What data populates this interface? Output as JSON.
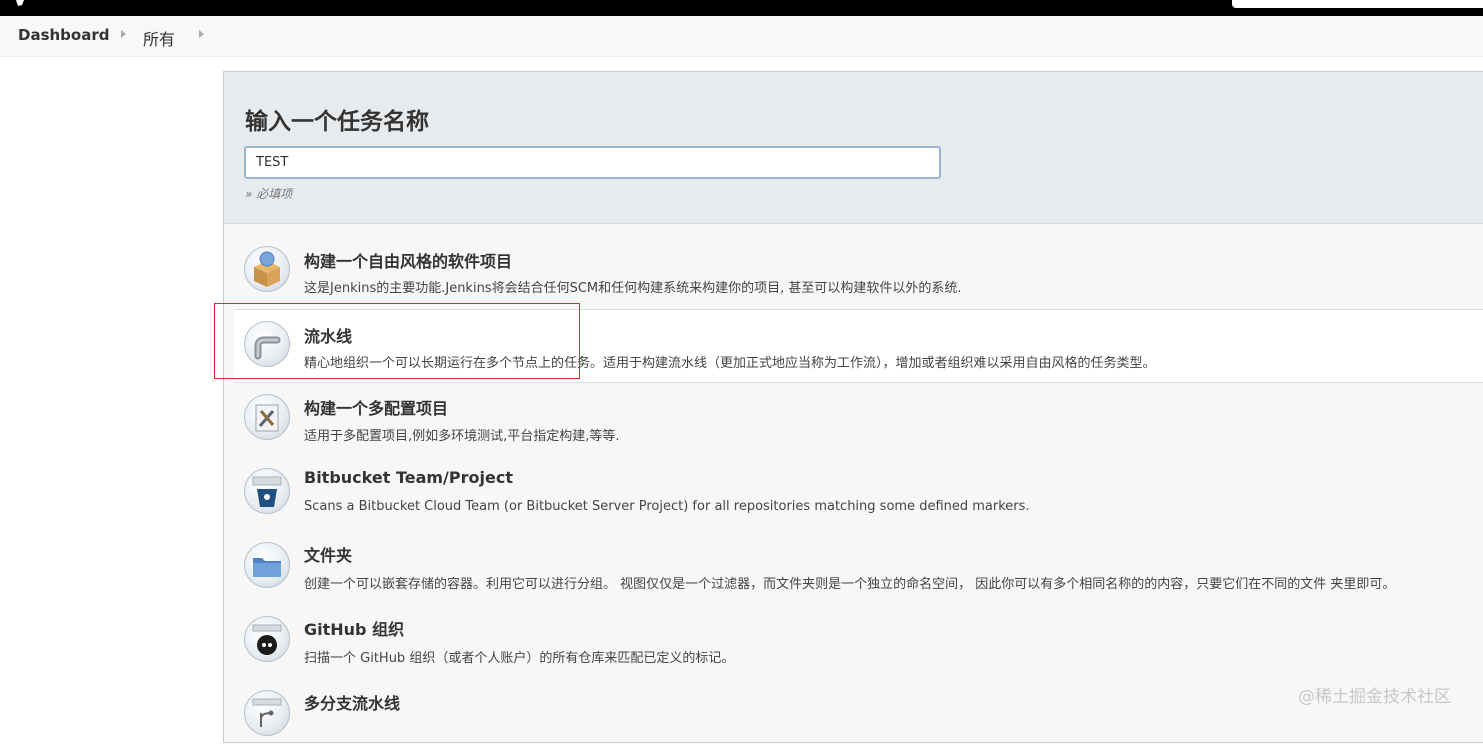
{
  "breadcrumb": {
    "dashboard": "Dashboard",
    "all": "所有"
  },
  "form": {
    "title": "输入一个任务名称",
    "name_value": "TEST",
    "required_hint": "» 必填项"
  },
  "job_types": [
    {
      "title": "构建一个自由风格的软件项目",
      "desc": "这是Jenkins的主要功能.Jenkins将会结合任何SCM和任何构建系统来构建你的项目, 甚至可以构建软件以外的系统.",
      "icon": "package-box-icon"
    },
    {
      "title": "流水线",
      "desc": "精心地组织一个可以长期运行在多个节点上的任务。适用于构建流水线（更加正式地应当称为工作流），增加或者组织难以采用自由风格的任务类型。",
      "icon": "pipe-icon"
    },
    {
      "title": "构建一个多配置项目",
      "desc": "适用于多配置项目,例如多环境测试,平台指定构建,等等.",
      "icon": "tools-icon"
    },
    {
      "title": "Bitbucket Team/Project",
      "desc": "Scans a Bitbucket Cloud Team (or Bitbucket Server Project) for all repositories matching some defined markers.",
      "icon": "bitbucket-icon"
    },
    {
      "title": "文件夹",
      "desc": "创建一个可以嵌套存储的容器。利用它可以进行分组。 视图仅仅是一个过滤器，而文件夹则是一个独立的命名空间， 因此你可以有多个相同名称的的内容，只要它们在不同的文件 夹里即可。",
      "icon": "folder-icon"
    },
    {
      "title": "GitHub 组织",
      "desc": "扫描一个 GitHub 组织（或者个人账户）的所有仓库来匹配已定义的标记。",
      "icon": "github-icon"
    },
    {
      "title": "多分支流水线",
      "desc": "",
      "icon": "branch-icon"
    }
  ],
  "watermark": "@稀土掘金技术社区"
}
